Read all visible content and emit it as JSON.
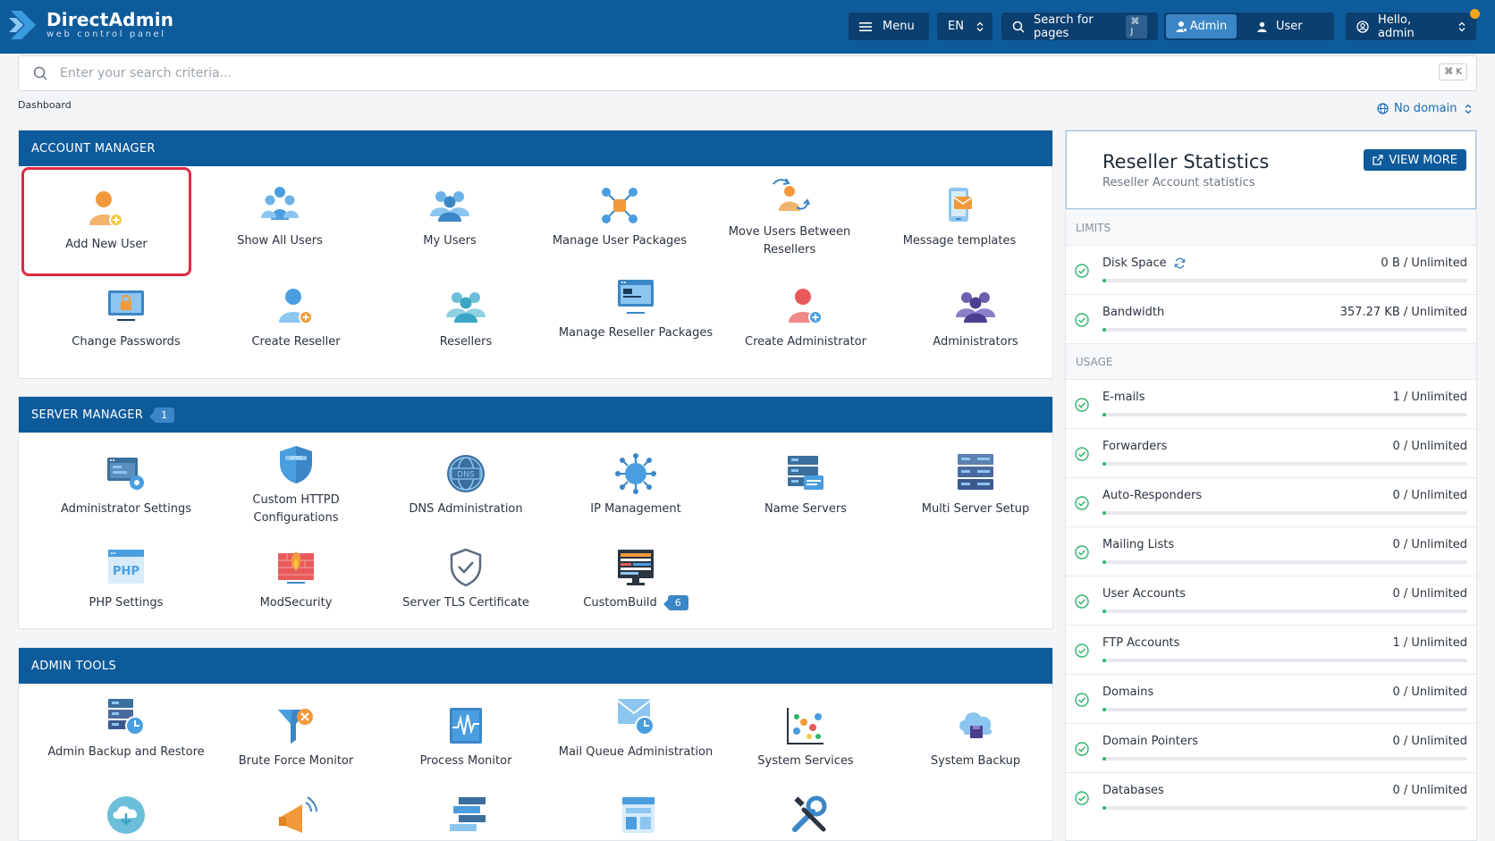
{
  "header": {
    "logo_name": "DirectAdmin",
    "logo_sub": "web control panel",
    "menu_label": "Menu",
    "lang_label": "EN",
    "search_pages_label": "Search for pages",
    "search_pages_kbd": "⌘ J",
    "admin_label": "Admin",
    "user_label": "User",
    "greeting": "Hello, admin"
  },
  "search": {
    "placeholder": "Enter your search criteria...",
    "kbd": "⌘ K"
  },
  "breadcrumb": "Dashboard",
  "domain_selector": "No domain",
  "account_manager": {
    "title": "ACCOUNT MANAGER",
    "items": [
      {
        "label": "Add New User",
        "icon": "add-user-icon"
      },
      {
        "label": "Show All Users",
        "icon": "users-group-icon"
      },
      {
        "label": "My Users",
        "icon": "my-users-icon"
      },
      {
        "label": "Manage User Packages",
        "icon": "packages-icon"
      },
      {
        "label": "Move Users Between Resellers",
        "icon": "move-users-icon"
      },
      {
        "label": "Message templates",
        "icon": "message-templates-icon"
      },
      {
        "label": "Change Passwords",
        "icon": "change-password-icon"
      },
      {
        "label": "Create Reseller",
        "icon": "create-reseller-icon"
      },
      {
        "label": "Resellers",
        "icon": "resellers-icon"
      },
      {
        "label": "Manage Reseller Packages",
        "icon": "reseller-packages-icon"
      },
      {
        "label": "Create Administrator",
        "icon": "create-admin-icon"
      },
      {
        "label": "Administrators",
        "icon": "administrators-icon"
      }
    ]
  },
  "server_manager": {
    "title": "SERVER MANAGER",
    "badge": "1",
    "items": [
      {
        "label": "Administrator Settings",
        "icon": "admin-settings-icon"
      },
      {
        "label": "Custom HTTPD Configurations",
        "icon": "httpd-shield-icon"
      },
      {
        "label": "DNS Administration",
        "icon": "dns-icon"
      },
      {
        "label": "IP Management",
        "icon": "ip-network-icon"
      },
      {
        "label": "Name Servers",
        "icon": "name-servers-icon"
      },
      {
        "label": "Multi Server Setup",
        "icon": "multi-server-icon"
      },
      {
        "label": "PHP Settings",
        "icon": "php-icon"
      },
      {
        "label": "ModSecurity",
        "icon": "modsecurity-icon"
      },
      {
        "label": "Server TLS Certificate",
        "icon": "tls-shield-icon"
      },
      {
        "label": "CustomBuild",
        "icon": "custombuild-icon",
        "badge": "6"
      }
    ]
  },
  "admin_tools": {
    "title": "ADMIN TOOLS",
    "items": [
      {
        "label": "Admin Backup and Restore",
        "icon": "backup-restore-icon"
      },
      {
        "label": "Brute Force Monitor",
        "icon": "brute-force-icon"
      },
      {
        "label": "Process Monitor",
        "icon": "process-monitor-icon"
      },
      {
        "label": "Mail Queue Administration",
        "icon": "mail-queue-icon"
      },
      {
        "label": "System Services",
        "icon": "system-services-icon"
      },
      {
        "label": "System Backup",
        "icon": "system-backup-icon"
      }
    ],
    "partial_icons": [
      "cloud-download-icon",
      "megaphone-icon",
      "stack-icon",
      "layout-icon",
      "tools-icon"
    ]
  },
  "reseller_stats": {
    "title": "Reseller Statistics",
    "subtitle": "Reseller Account statistics",
    "view_more": "VIEW MORE",
    "limits_label": "LIMITS",
    "usage_label": "USAGE",
    "limits": [
      {
        "name": "Disk Space",
        "value": "0 B / Unlimited",
        "refresh": true
      },
      {
        "name": "Bandwidth",
        "value": "357.27 KB / Unlimited"
      }
    ],
    "usage": [
      {
        "name": "E-mails",
        "value": "1 / Unlimited"
      },
      {
        "name": "Forwarders",
        "value": "0 / Unlimited"
      },
      {
        "name": "Auto-Responders",
        "value": "0 / Unlimited"
      },
      {
        "name": "Mailing Lists",
        "value": "0 / Unlimited"
      },
      {
        "name": "User Accounts",
        "value": "0 / Unlimited"
      },
      {
        "name": "FTP Accounts",
        "value": "1 / Unlimited"
      },
      {
        "name": "Domains",
        "value": "0 / Unlimited"
      },
      {
        "name": "Domain Pointers",
        "value": "0 / Unlimited"
      },
      {
        "name": "Databases",
        "value": "0 / Unlimited"
      }
    ]
  },
  "colors": {
    "brand": "#0e5b9b",
    "accent": "#3b86c6",
    "highlight": "#e02a43",
    "ok": "#30b46c"
  }
}
